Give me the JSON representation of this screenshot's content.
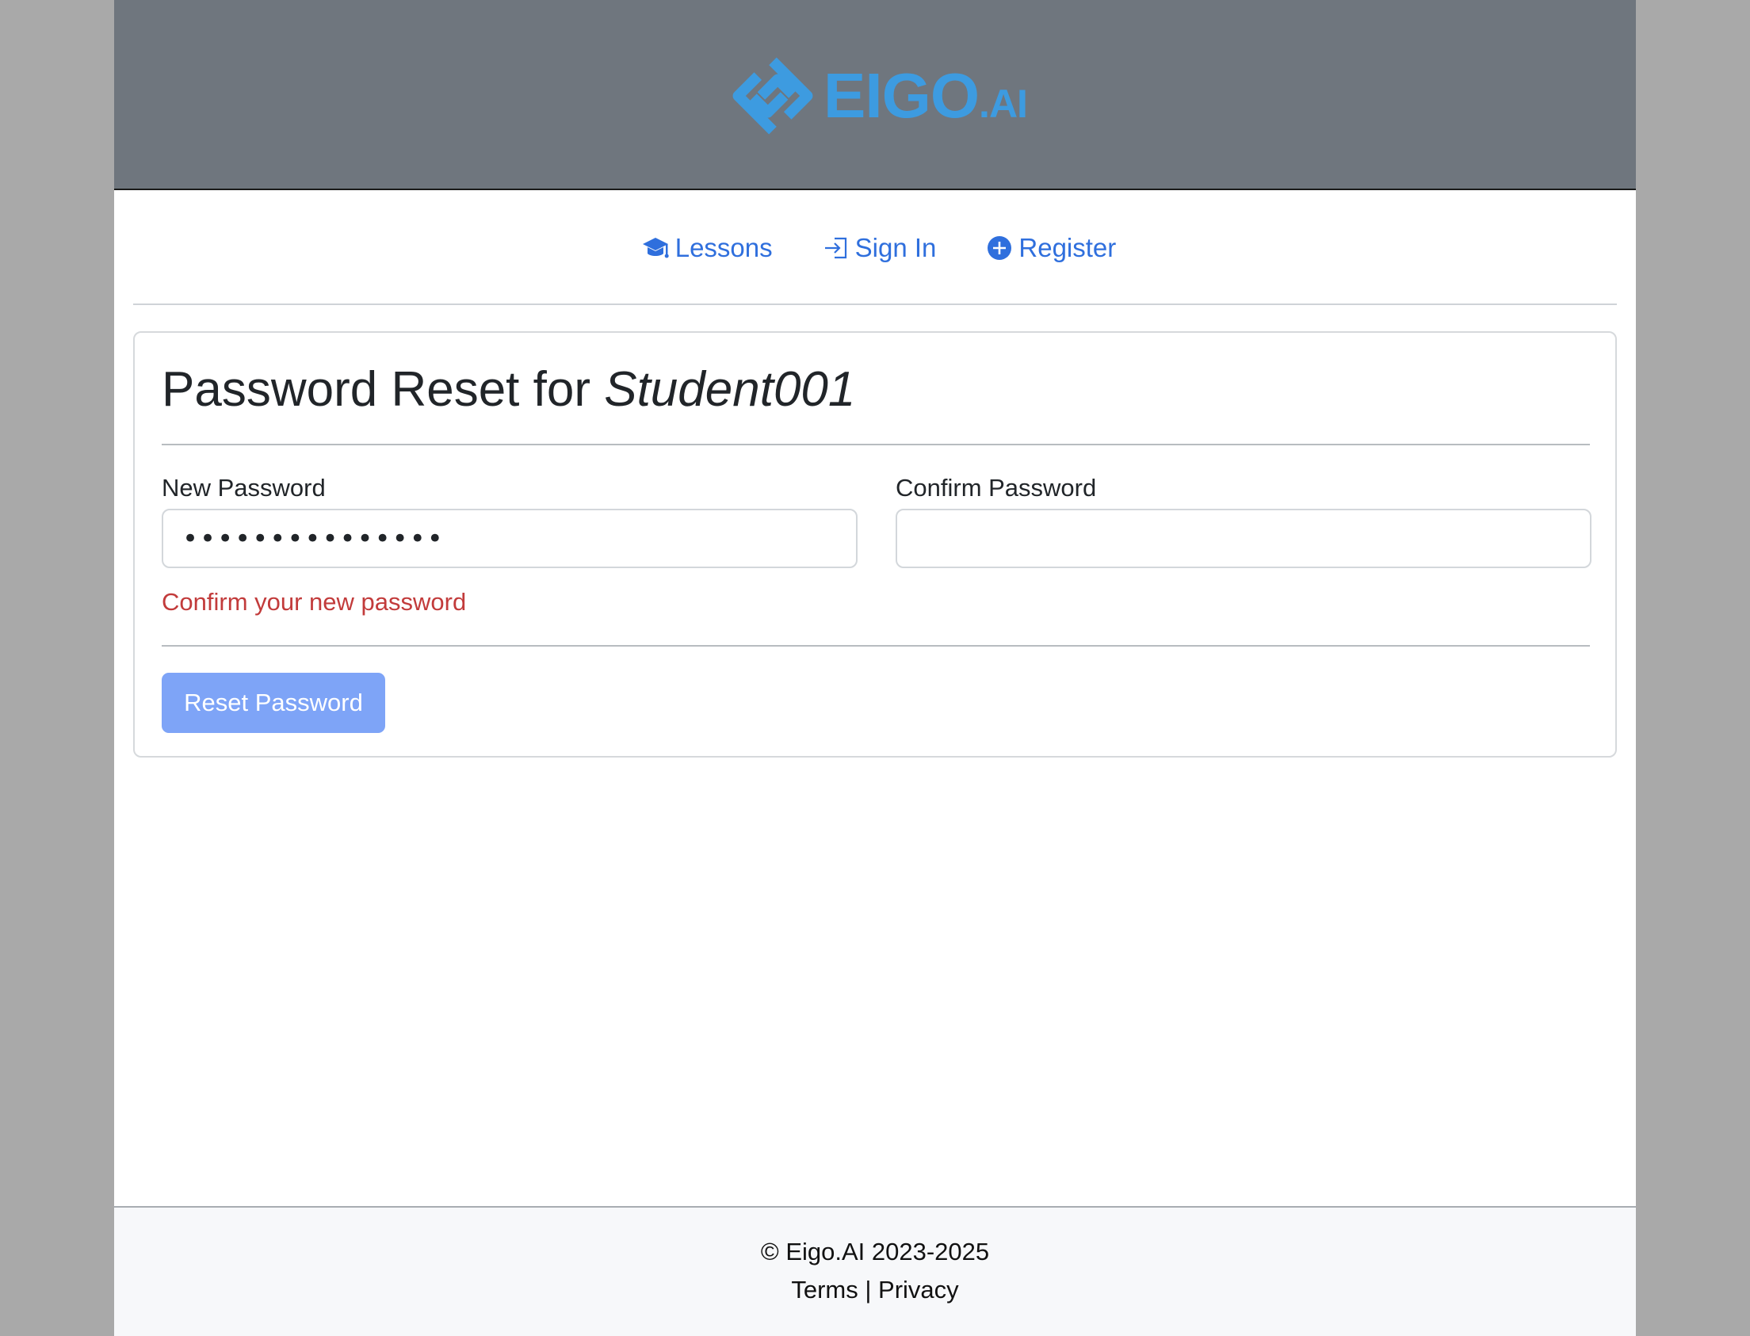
{
  "brand": {
    "name": "EIGO",
    "suffix": ".AI",
    "color": "#3d9be0"
  },
  "nav": {
    "lessons": {
      "label": "Lessons",
      "icon": "graduation-cap-icon"
    },
    "signin": {
      "label": "Sign In",
      "icon": "sign-in-icon"
    },
    "register": {
      "label": "Register",
      "icon": "plus-circle-icon"
    },
    "link_color": "#2f6fdd"
  },
  "form": {
    "title_prefix": "Password Reset for ",
    "username": "Student001",
    "new_password": {
      "label": "New Password",
      "value": "•••••••••••••••"
    },
    "confirm_password": {
      "label": "Confirm Password",
      "value": ""
    },
    "error": "Confirm your new password",
    "error_color": "#c23b3b",
    "submit_label": "Reset Password",
    "submit_color": "#7ea4f7"
  },
  "footer": {
    "copyright": "© Eigo.AI 2023-2025",
    "terms": "Terms",
    "separator": "|",
    "privacy": "Privacy"
  }
}
